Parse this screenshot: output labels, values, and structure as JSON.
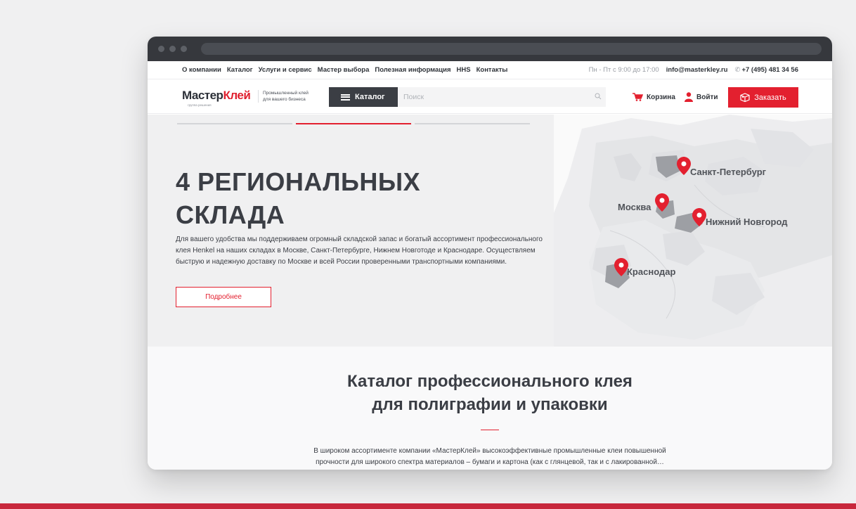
{
  "topnav": {
    "items": [
      "О компании",
      "Каталог",
      "Услуги и сервис",
      "Мастер выбора",
      "Полезная информация",
      "HHS",
      "Контакты"
    ],
    "hours": "Пн - Пт с 9:00 до 17:00",
    "email": "info@masterkley.ru",
    "phone": "+7 (495) 481 34 56"
  },
  "header": {
    "logo_dark": "Мастер",
    "logo_red": "Клей",
    "logo_sub": "группа решения",
    "tagline_1": "Промышленный клей",
    "tagline_2": "для вашего бизнеса",
    "catalog_label": "Каталог",
    "search_placeholder": "Поиск",
    "cart_label": "Корзина",
    "login_label": "Войти",
    "order_label": "Заказать"
  },
  "hero": {
    "title_line1": "4 РЕГИОНАЛЬНЫХ",
    "title_line2": "СКЛАДА",
    "text": "Для вашего удобства мы поддерживаем огромный складской запас и богатый ассортимент профессионального клея Henkel на наших складах в Москве, Санкт-Петербурге, Нижнем Новготоде и Краснодаре. Осуществляем быструю и надежную доставку по Москве и всей России проверенными транспортными компаниями.",
    "more_label": "Подробнее",
    "cities": {
      "spb": "Санкт-Петербург",
      "msk": "Москва",
      "nn": "Нижний Новгород",
      "krd": "Краснодар"
    }
  },
  "catalog": {
    "title_line1": "Каталог профессионального клея",
    "title_line2": "для полиграфии и упаковки",
    "text_line1": "В широком ассортименте компании «МастерКлей» высокоэффективные промышленные клеи повышенной",
    "text_line2": "прочности для широкого спектра материалов – бумаги и картона (как с глянцевой, так и с лакированной…"
  },
  "colors": {
    "accent": "#e3202f",
    "dark": "#3b3e45"
  }
}
